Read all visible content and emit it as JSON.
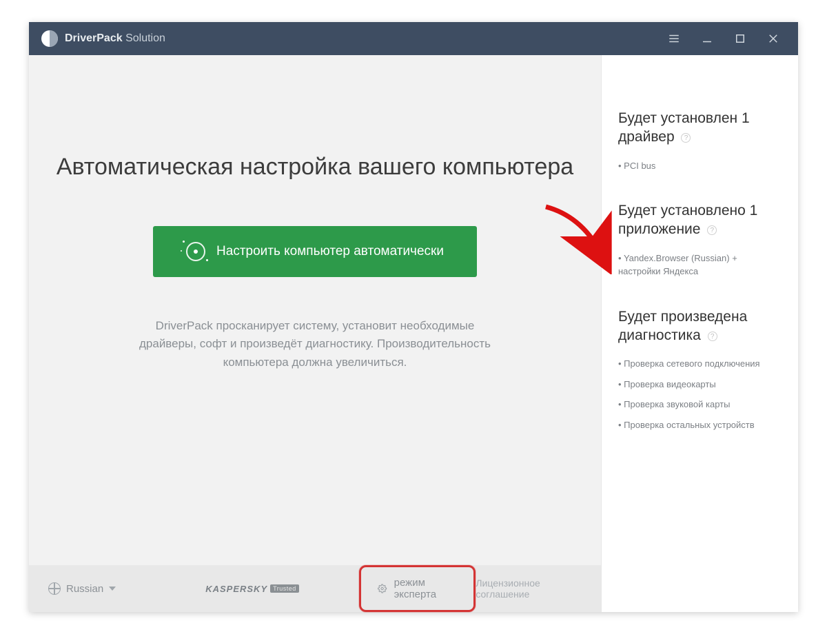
{
  "titlebar": {
    "brand_bold": "DriverPack",
    "brand_thin": "Solution"
  },
  "main": {
    "heading": "Автоматическая настройка вашего компьютера",
    "cta_label": "Настроить компьютер автоматически",
    "description": "DriverPack просканирует систему, установит необходимые драйверы, софт и произведёт диагностику. Производительность компьютера должна увеличиться."
  },
  "sidebar": {
    "drivers": {
      "title": "Будет установлен 1 драйвер",
      "items": [
        "PCI bus"
      ]
    },
    "apps": {
      "title": "Будет установлено 1 приложение",
      "items": [
        "Yandex.Browser (Russian) + настройки Яндекса"
      ]
    },
    "diag": {
      "title": "Будет произведена диагностика",
      "items": [
        "Проверка сетевого подключения",
        "Проверка видеокарты",
        "Проверка звуковой карты",
        "Проверка остальных устройств"
      ]
    }
  },
  "footer": {
    "language": "Russian",
    "kaspersky_label": "KASPERSKY",
    "trusted_label": "Trusted",
    "expert_label": "режим эксперта",
    "license_label": "Лицензионное соглашение"
  }
}
